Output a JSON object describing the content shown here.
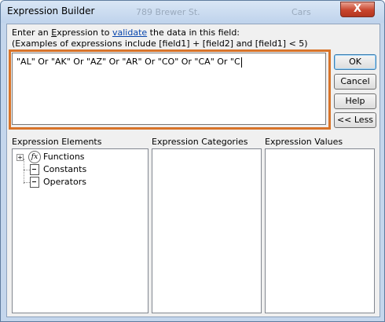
{
  "window": {
    "title": "Expression Builder",
    "ghost_text_1": "789 Brewer St.",
    "ghost_text_2": "Cars",
    "close_symbol": "X"
  },
  "prompt": {
    "line1_before": "Enter an ",
    "line1_underlined": "E",
    "line1_after_u": "xpression to ",
    "link_text": "validate",
    "line1_end": " the data in this field:",
    "line2": "(Examples of expressions include [field1] + [field2] and [field1] < 5)"
  },
  "expression": {
    "value": "\"AL\" Or \"AK\" Or \"AZ\" Or \"AR\" Or \"CO\" Or \"CA\" Or \"C"
  },
  "buttons": {
    "ok": "OK",
    "cancel": "Cancel",
    "help": "Help",
    "less": "<< Less"
  },
  "panels": {
    "elements_header": "Expression Elements",
    "categories_header": "Expression Categories",
    "values_header": "Expression Values"
  },
  "tree": {
    "items": [
      {
        "label": "Functions",
        "icon": "function-fx-icon",
        "expander": "+"
      },
      {
        "label": "Constants",
        "icon": "constants-folder-icon"
      },
      {
        "label": "Operators",
        "icon": "operators-folder-icon"
      }
    ]
  },
  "colors": {
    "highlight_border": "#d8742a",
    "link": "#0645ad"
  }
}
